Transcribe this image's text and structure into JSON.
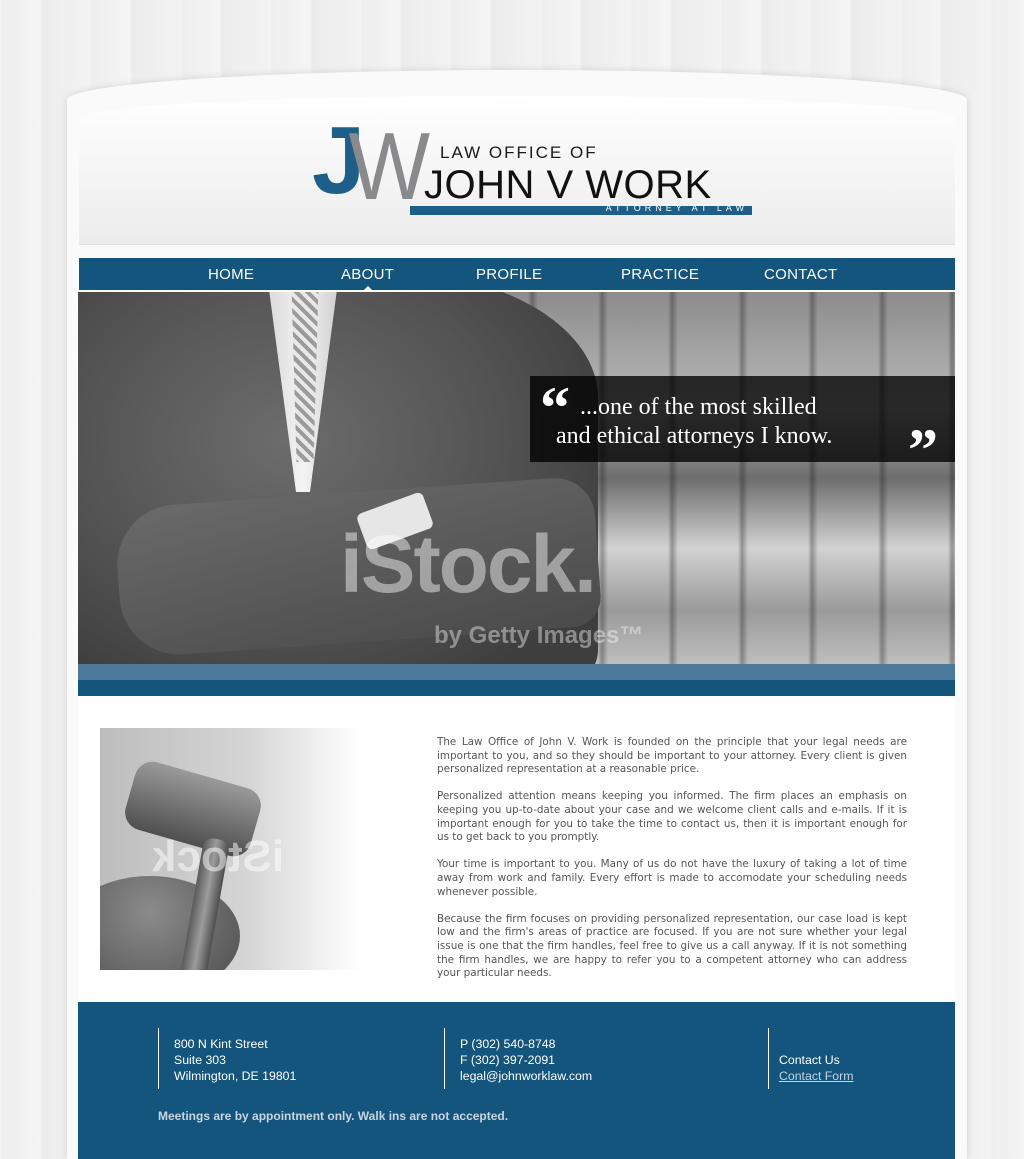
{
  "logo": {
    "initial_j": "J",
    "initial_w": "W",
    "line_small": "LAW OFFICE OF",
    "line_big": "JOHN V WORK",
    "tagline": "ATTORNEY AT LAW"
  },
  "nav": {
    "items": [
      {
        "label": "HOME"
      },
      {
        "label": "ABOUT",
        "active": true
      },
      {
        "label": "PROFILE"
      },
      {
        "label": "PRACTICE"
      },
      {
        "label": "CONTACT"
      }
    ]
  },
  "hero": {
    "quote_open": "“",
    "quote_close": "”",
    "quote_line1": "...one of the most skilled",
    "quote_line2": "and ethical attorneys I know.",
    "watermark": "iStock.",
    "watermark_sub": "by Getty Images™"
  },
  "about": {
    "gavel_watermark": "iStock",
    "paragraphs": [
      "The Law Office of John V. Work is founded on the principle that your legal needs are important to you, and so they should be important to your attorney. Every client is given personalized representation at a reasonable price.",
      "Personalized attention means keeping you informed. The firm places an emphasis on keeping you up-to-date about your case and we welcome client calls and e-mails. If it is important enough for you to take the time to contact us, then it is important enough for us to get back to you promptly.",
      "Your time is important to you. Many of us do not have the luxury of taking a lot of time away from work and family. Every effort is made to accomodate your scheduling needs whenever possible.",
      "Because the firm focuses on providing personalized representation, our case load is kept low and the firm's areas of practice are focused. If you are not sure whether your legal issue is one that the firm handles, feel free to give us a call anyway. If it is not something the firm handles, we are happy to refer you to a competent attorney who can address your particular needs."
    ]
  },
  "footer": {
    "address": {
      "line1": "800 N Kint Street",
      "line2": "Suite 303",
      "line3": "Wilmington, DE 19801"
    },
    "contact": {
      "phone": "P (302) 540-8748",
      "fax": "F (302) 397-2091",
      "email": "legal@johnworklaw.com"
    },
    "contact_us": {
      "heading": "Contact Us",
      "link": "Contact Form"
    },
    "note": "Meetings are by appointment only. Walk ins are not accepted."
  },
  "colors": {
    "brand_blue": "#14557d",
    "logo_blue": "#1d5f88",
    "logo_gray": "#8a8a8c"
  }
}
